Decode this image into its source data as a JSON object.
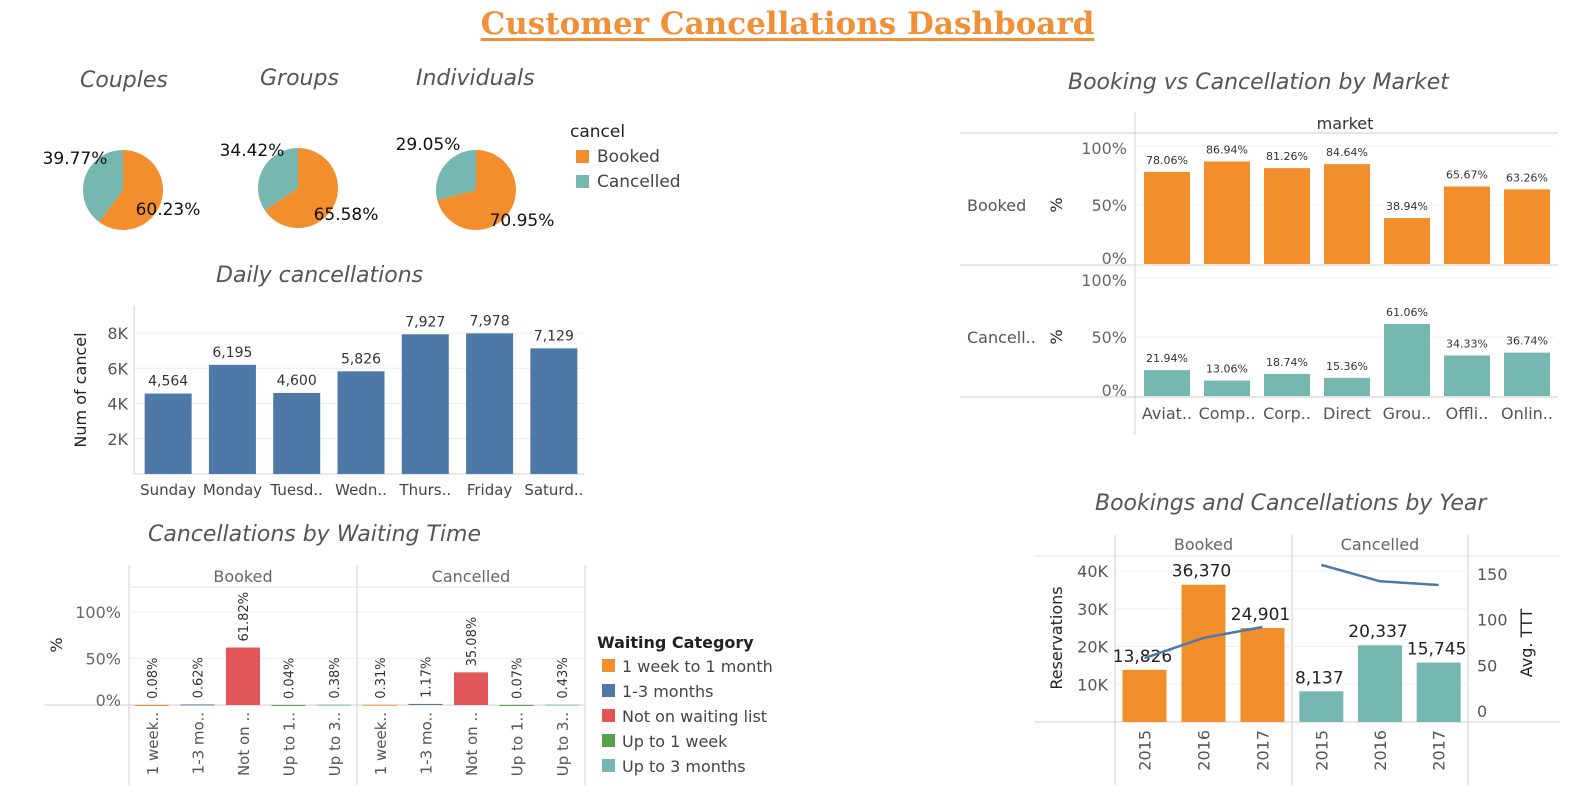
{
  "dashboard": {
    "title": "Customer Cancellations Dashboard"
  },
  "colors": {
    "booked": "#f28e2b",
    "cancelled": "#76b7b2",
    "blue": "#4e79a7",
    "red": "#e15759",
    "green": "#59a14f",
    "title_orange": "#f0913a"
  },
  "pies": {
    "legend_title": "cancel",
    "legend": [
      "Booked",
      "Cancelled"
    ],
    "items": [
      {
        "title": "Couples",
        "booked_label": "60.23%",
        "cancelled_label": "39.77%"
      },
      {
        "title": "Groups",
        "booked_label": "65.58%",
        "cancelled_label": "34.42%"
      },
      {
        "title": "Individuals",
        "booked_label": "70.95%",
        "cancelled_label": "29.05%"
      }
    ]
  },
  "daily": {
    "title": "Daily cancellations"
  },
  "waiting": {
    "title": "Cancellations by Waiting Time",
    "legend_title": "Waiting Category",
    "legend": [
      "1 week to 1 month",
      "1-3 months",
      "Not on waiting list",
      "Up to 1 week",
      "Up to 3 months"
    ],
    "ylabel": "%"
  },
  "market": {
    "title": "Booking vs Cancellation by Market"
  },
  "year": {
    "title": "Bookings and Cancellations by Year"
  },
  "chart_data": [
    {
      "type": "pie",
      "title": "Couples",
      "categories": [
        "Booked",
        "Cancelled"
      ],
      "values": [
        60.23,
        39.77
      ]
    },
    {
      "type": "pie",
      "title": "Groups",
      "categories": [
        "Booked",
        "Cancelled"
      ],
      "values": [
        65.58,
        34.42
      ]
    },
    {
      "type": "pie",
      "title": "Individuals",
      "categories": [
        "Booked",
        "Cancelled"
      ],
      "values": [
        70.95,
        29.05
      ]
    },
    {
      "type": "bar",
      "title": "Daily cancellations",
      "categories": [
        "Sunday",
        "Monday",
        "Tuesd..",
        "Wedn..",
        "Thurs..",
        "Friday",
        "Saturd.."
      ],
      "values": [
        4564,
        6195,
        4600,
        5826,
        7927,
        7978,
        7129
      ],
      "value_labels": [
        "4,564",
        "6,195",
        "4,600",
        "5,826",
        "7,927",
        "7,978",
        "7,129"
      ],
      "ylabel": "Num of cancel",
      "ylim": [
        0,
        8000
      ],
      "yticks": [
        2000,
        4000,
        6000,
        8000
      ],
      "ytick_labels": [
        "2K",
        "4K",
        "6K",
        "8K"
      ]
    },
    {
      "type": "bar",
      "title": "Cancellations by Waiting Time",
      "ylabel": "%",
      "ylim": [
        0,
        100
      ],
      "yticks": [
        0,
        50,
        100
      ],
      "ytick_labels": [
        "0%",
        "50%",
        "100%"
      ],
      "panels": [
        {
          "name": "Booked",
          "categories": [
            "1 week..",
            "1-3 mo..",
            "Not on ..",
            "Up to 1..",
            "Up to 3.."
          ],
          "values": [
            0.08,
            0.62,
            61.82,
            0.04,
            0.38
          ],
          "value_labels": [
            "0.08%",
            "0.62%",
            "61.82%",
            "0.04%",
            "0.38%"
          ]
        },
        {
          "name": "Cancelled",
          "categories": [
            "1 week..",
            "1-3 mo..",
            "Not on ..",
            "Up to 1..",
            "Up to 3.."
          ],
          "values": [
            0.31,
            1.17,
            35.08,
            0.07,
            0.43
          ],
          "value_labels": [
            "0.31%",
            "1.17%",
            "35.08%",
            "0.07%",
            "0.43%"
          ]
        }
      ]
    },
    {
      "type": "bar",
      "title": "Booking vs Cancellation by Market",
      "column_header": "market",
      "categories": [
        "Aviat..",
        "Comp..",
        "Corp..",
        "Direct",
        "Grou..",
        "Offli..",
        "Onlin.."
      ],
      "ylim": [
        0,
        100
      ],
      "yticks": [
        0,
        50,
        100
      ],
      "ytick_labels": [
        "0%",
        "50%",
        "100%"
      ],
      "ylabel": "%",
      "series": [
        {
          "name": "Booked",
          "row_label": "Booked",
          "values": [
            78.06,
            86.94,
            81.26,
            84.64,
            38.94,
            65.67,
            63.26
          ],
          "value_labels": [
            "78.06%",
            "86.94%",
            "81.26%",
            "84.64%",
            "38.94%",
            "65.67%",
            "63.26%"
          ]
        },
        {
          "name": "Cancelled",
          "row_label": "Cancell..",
          "values": [
            21.94,
            13.06,
            18.74,
            15.36,
            61.06,
            34.33,
            36.74
          ],
          "value_labels": [
            "21.94%",
            "13.06%",
            "18.74%",
            "15.36%",
            "61.06%",
            "34.33%",
            "36.74%"
          ]
        }
      ]
    },
    {
      "type": "bar",
      "title": "Bookings and Cancellations by Year",
      "ylabel": "Reservations",
      "y2label": "Avg. TTT",
      "ylim": [
        0,
        44000
      ],
      "yticks": [
        10000,
        20000,
        30000,
        40000
      ],
      "ytick_labels": [
        "10K",
        "20K",
        "30K",
        "40K"
      ],
      "y2lim": [
        0,
        170
      ],
      "y2ticks": [
        0,
        50,
        100,
        150
      ],
      "y2tick_labels": [
        "0",
        "50",
        "100",
        "150"
      ],
      "panels": [
        {
          "name": "Booked",
          "categories": [
            "2015",
            "2016",
            "2017"
          ],
          "values": [
            13826,
            36370,
            24901
          ],
          "value_labels": [
            "13,826",
            "36,370",
            "24,901"
          ],
          "avg_ttt": [
            58,
            80,
            92
          ]
        },
        {
          "name": "Cancelled",
          "categories": [
            "2015",
            "2016",
            "2017"
          ],
          "values": [
            8137,
            20337,
            15745
          ],
          "value_labels": [
            "8,137",
            "20,337",
            "15,745"
          ],
          "avg_ttt": [
            160,
            142,
            138
          ]
        }
      ]
    }
  ]
}
